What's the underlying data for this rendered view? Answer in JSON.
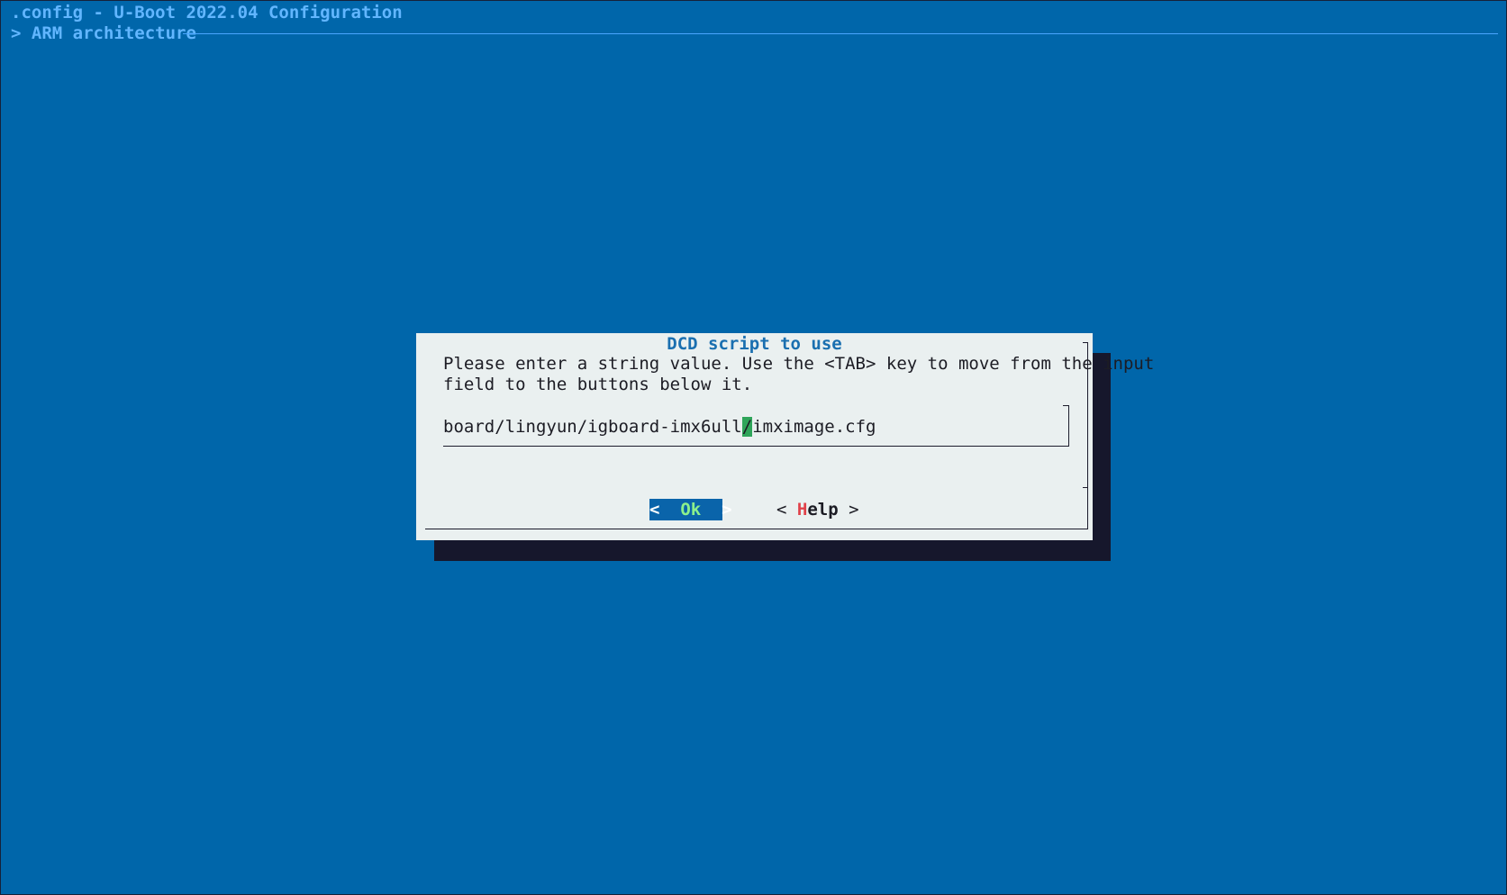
{
  "terminal": {
    "title": ".config - U-Boot 2022.04 Configuration",
    "breadcrumb": "> ARM architecture"
  },
  "dialog": {
    "title": "DCD script to use",
    "prompt_line1": "Please enter a string value. Use the <TAB> key to move from the input",
    "prompt_line2": "field to the buttons below it.",
    "input": {
      "value_before_cursor": "board/lingyun/igboard-imx6ull",
      "cursor_char": "/",
      "value_after_cursor": "imximage.cfg"
    },
    "buttons": {
      "ok_left": "<",
      "ok_label": "Ok",
      "ok_right": ">",
      "help_left": "< ",
      "help_hotkey": "H",
      "help_rest": "elp",
      "help_right": " >"
    }
  },
  "colors": {
    "background": "#0066aa",
    "dialog": "#eaf0f0",
    "accent_title": "#1a6fb0",
    "hotkey": "#e0424a",
    "cursor": "#2fa55a",
    "selected_button": "#0a64aa"
  }
}
